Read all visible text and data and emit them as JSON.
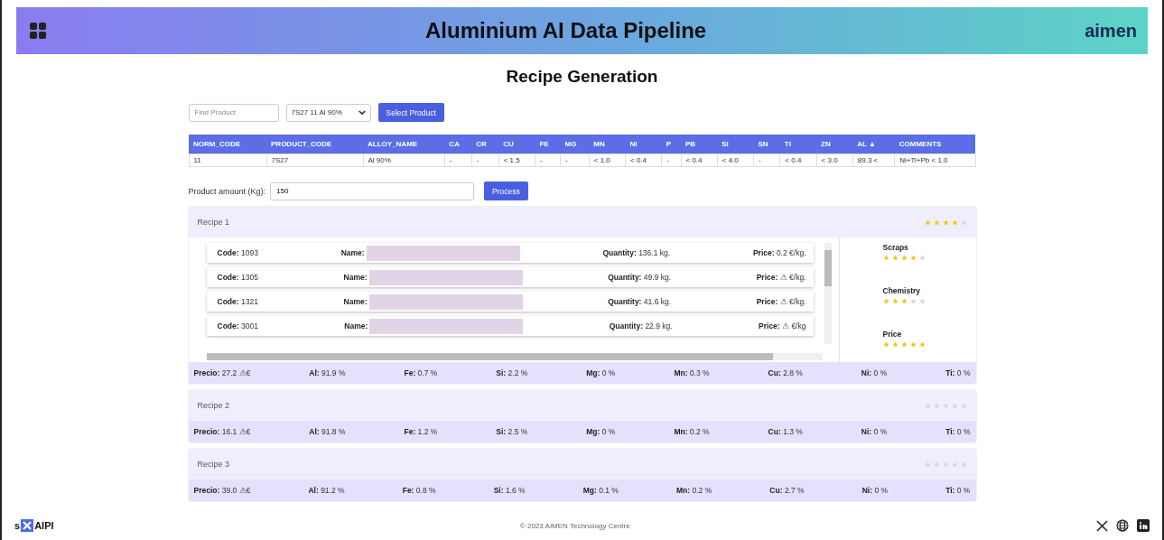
{
  "header": {
    "title": "Aluminium AI Data Pipeline",
    "logo_text": "aimen"
  },
  "page_title": "Recipe Generation",
  "search": {
    "placeholder": "Find Product"
  },
  "product_select": {
    "value": "7S27 11 Al 90%"
  },
  "select_button": "Select Product",
  "table": {
    "columns": [
      "NORM_CODE",
      "PRODUCT_CODE",
      "ALLOY_NAME",
      "CA",
      "CR",
      "CU",
      "FE",
      "MG",
      "MN",
      "NI",
      "P",
      "PB",
      "SI",
      "SN",
      "TI",
      "ZN",
      "AL ▲",
      "COMMENTS"
    ],
    "rows": [
      [
        "11",
        "7S27",
        "Al 90%",
        "-",
        "-",
        "< 1.5",
        "-",
        "-",
        "< 1.0",
        "< 0.4",
        "-",
        "< 0.4",
        "< 4.0",
        "-",
        "< 0.4",
        "< 3.0",
        "89.3 <",
        "Ni+Ti+Pb < 1.0"
      ]
    ]
  },
  "amount": {
    "label": "Product amount (Kg):",
    "value": "150"
  },
  "process_button": "Process",
  "recipes": [
    {
      "title": "Recipe 1",
      "stars": 4,
      "expanded": true,
      "scraps": [
        {
          "code": "**Code:** 1093",
          "name_label": "Name:",
          "quantity": "**Quantity:** 136.1 kg.",
          "price": "**Price:** 0.2 €/kg."
        },
        {
          "code": "**Code:** 1305",
          "name_label": "Name:",
          "quantity": "**Quantity:** 49.9 kg.",
          "price": "**Price:** ⚠ €/kg."
        },
        {
          "code": "**Code:** 1321",
          "name_label": "Name:",
          "quantity": "**Quantity:** 41.6 kg.",
          "price": "**Price:** ⚠ €/kg."
        },
        {
          "code": "**Code:** 3001",
          "name_label": "Name:",
          "quantity": "**Quantity:** 22.9 kg.",
          "price": "**Price:** ⚠ €/kg"
        }
      ],
      "ratings": [
        {
          "label": "Scraps",
          "stars": 4
        },
        {
          "label": "Chemistry",
          "stars": 3
        },
        {
          "label": "Price",
          "stars": 5
        }
      ],
      "summary": [
        "**Precio:** 27.2 ⚠€",
        "**Al:** 91.9 %",
        "**Fe:** 0.7 %",
        "**Si:** 2.2 %",
        "**Mg:** 0 %",
        "**Mn:** 0.3 %",
        "**Cu:** 2.8 %",
        "**Ni:** 0 %",
        "**Ti:** 0 %"
      ]
    },
    {
      "title": "Recipe 2",
      "stars": 0,
      "expanded": false,
      "summary": [
        "**Precio:** 16.1 ⚠€",
        "**Al:** 91.8 %",
        "**Fe:** 1.2 %",
        "**Si:** 2.5 %",
        "**Mg:** 0 %",
        "**Mn:** 0.2 %",
        "**Cu:** 1.3 %",
        "**Ni:** 0 %",
        "**Ti:** 0 %"
      ]
    },
    {
      "title": "Recipe 3",
      "stars": 0,
      "expanded": false,
      "summary": [
        "**Precio:** 39.0 ⚠€",
        "**Al:** 91.2 %",
        "**Fe:** 0.8 %",
        "**Si:** 1.6 %",
        "**Mg:** 0.1 %",
        "**Mn:** 0.2 %",
        "**Cu:** 2.7 %",
        "**Ni:** 0 %",
        "**Ti:** 0 %"
      ]
    }
  ],
  "footer": {
    "brand_start": "s",
    "brand_end": "AIPI",
    "copyright": "© 2023 AIMEN Technology Centre"
  }
}
